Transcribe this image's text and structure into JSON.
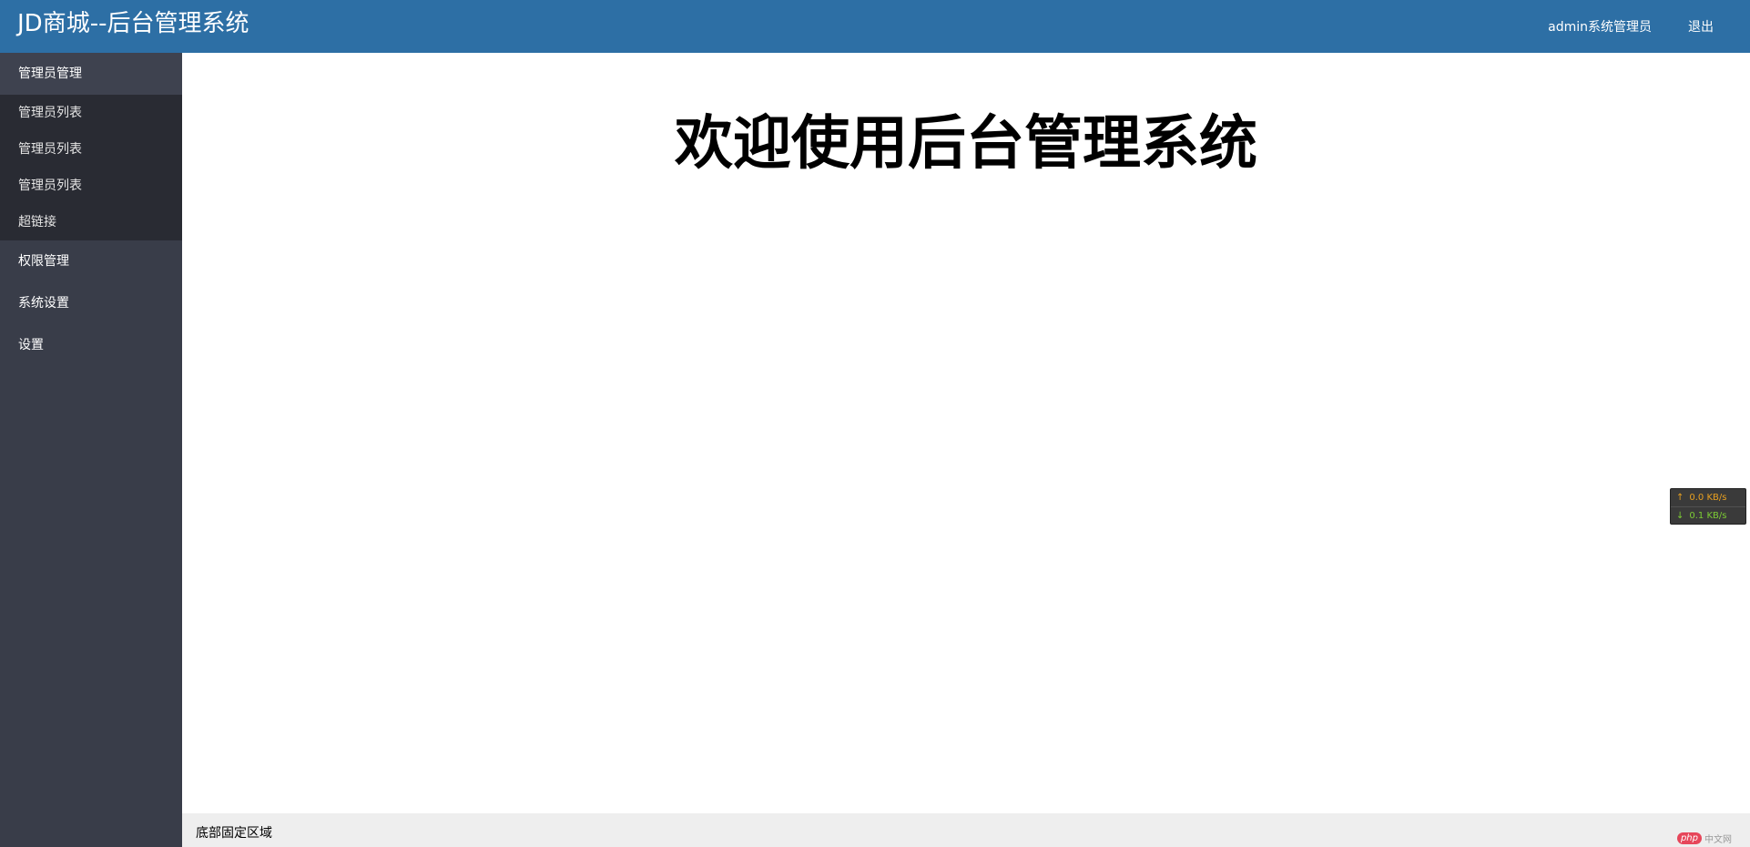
{
  "header": {
    "title": "JD商城--后台管理系统",
    "user_label": "admin系统管理员",
    "logout_label": "退出",
    "background_color": "#2d6fa5"
  },
  "sidebar": {
    "background_color": "#393d49",
    "groups": [
      {
        "label": "管理员管理",
        "expanded": true,
        "items": [
          {
            "label": "管理员列表"
          },
          {
            "label": "管理员列表"
          },
          {
            "label": "管理员列表"
          },
          {
            "label": "超链接"
          }
        ]
      },
      {
        "label": "权限管理",
        "expanded": false
      },
      {
        "label": "系统设置",
        "expanded": false
      },
      {
        "label": "设置",
        "expanded": false
      }
    ]
  },
  "main": {
    "welcome_heading": "欢迎使用后台管理系统"
  },
  "footer": {
    "text": "底部固定区域",
    "watermark_badge": "php",
    "watermark_text": "中文网"
  },
  "speed_widget": {
    "upload_icon": "arrow-up-icon",
    "upload": "0.0 KB/s",
    "download_icon": "arrow-down-icon",
    "download": "0.1 KB/s"
  }
}
